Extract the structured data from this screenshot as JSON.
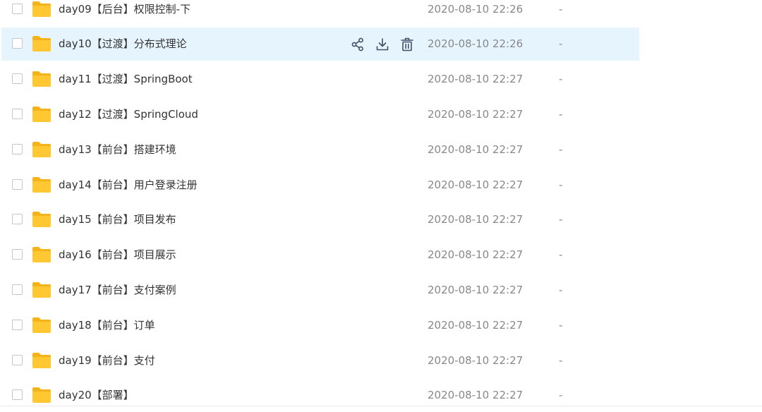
{
  "colors": {
    "folder": "#ffc832",
    "folder_tab": "#f5b31b",
    "hover_row": "#e6f4fd",
    "icon": "#424e67",
    "muted_text": "#888888"
  },
  "files": [
    {
      "name": "day09【后台】权限控制-下",
      "modified": "2020-08-10 22:26",
      "size": "-",
      "icon": "folder-icon",
      "checked": false,
      "hovered": false
    },
    {
      "name": "day10【过渡】分布式理论",
      "modified": "2020-08-10 22:26",
      "size": "-",
      "icon": "folder-icon",
      "checked": false,
      "hovered": true
    },
    {
      "name": "day11【过渡】SpringBoot",
      "modified": "2020-08-10 22:27",
      "size": "-",
      "icon": "folder-icon",
      "checked": false,
      "hovered": false
    },
    {
      "name": "day12【过渡】SpringCloud",
      "modified": "2020-08-10 22:27",
      "size": "-",
      "icon": "folder-icon",
      "checked": false,
      "hovered": false
    },
    {
      "name": "day13【前台】搭建环境",
      "modified": "2020-08-10 22:27",
      "size": "-",
      "icon": "folder-icon",
      "checked": false,
      "hovered": false
    },
    {
      "name": "day14【前台】用户登录注册",
      "modified": "2020-08-10 22:27",
      "size": "-",
      "icon": "folder-icon",
      "checked": false,
      "hovered": false
    },
    {
      "name": "day15【前台】项目发布",
      "modified": "2020-08-10 22:27",
      "size": "-",
      "icon": "folder-icon",
      "checked": false,
      "hovered": false
    },
    {
      "name": "day16【前台】项目展示",
      "modified": "2020-08-10 22:27",
      "size": "-",
      "icon": "folder-icon",
      "checked": false,
      "hovered": false
    },
    {
      "name": "day17【前台】支付案例",
      "modified": "2020-08-10 22:27",
      "size": "-",
      "icon": "folder-icon",
      "checked": false,
      "hovered": false
    },
    {
      "name": "day18【前台】订单",
      "modified": "2020-08-10 22:27",
      "size": "-",
      "icon": "folder-icon",
      "checked": false,
      "hovered": false
    },
    {
      "name": "day19【前台】支付",
      "modified": "2020-08-10 22:27",
      "size": "-",
      "icon": "folder-icon",
      "checked": false,
      "hovered": false
    },
    {
      "name": "day20【部署】",
      "modified": "2020-08-10 22:27",
      "size": "-",
      "icon": "folder-icon",
      "checked": false,
      "hovered": false
    }
  ],
  "row_actions": [
    {
      "action": "share",
      "icon": "share-icon"
    },
    {
      "action": "download",
      "icon": "download-icon"
    },
    {
      "action": "delete",
      "icon": "trash-icon"
    }
  ]
}
